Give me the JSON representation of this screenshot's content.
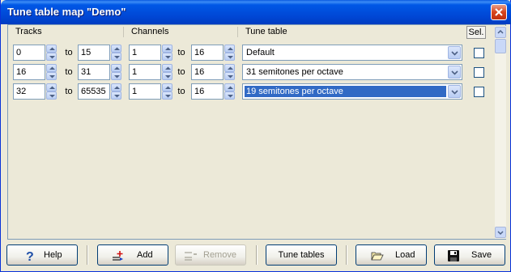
{
  "window": {
    "title": "Tune table map \"Demo\""
  },
  "header": {
    "tracks": "Tracks",
    "channels": "Channels",
    "tune_table": "Tune table",
    "sel": "Sel."
  },
  "rows": [
    {
      "track_from": "0",
      "to1": "to",
      "track_to": "15",
      "ch_from": "1",
      "to2": "to",
      "ch_to": "16",
      "tune_table": "Default",
      "selected": false
    },
    {
      "track_from": "16",
      "to1": "to",
      "track_to": "31",
      "ch_from": "1",
      "to2": "to",
      "ch_to": "16",
      "tune_table": "31 semitones per octave",
      "selected": false
    },
    {
      "track_from": "32",
      "to1": "to",
      "track_to": "65535",
      "ch_from": "1",
      "to2": "to",
      "ch_to": "16",
      "tune_table": "19 semitones per octave",
      "selected": false
    }
  ],
  "toolbar": {
    "help": "Help",
    "add": "Add",
    "remove": "Remove",
    "tune_tables": "Tune tables",
    "load": "Load",
    "save": "Save"
  },
  "colors": {
    "title_bar": "#0054e3",
    "selection": "#316ac5",
    "dialog_bg": "#ece9d8"
  }
}
